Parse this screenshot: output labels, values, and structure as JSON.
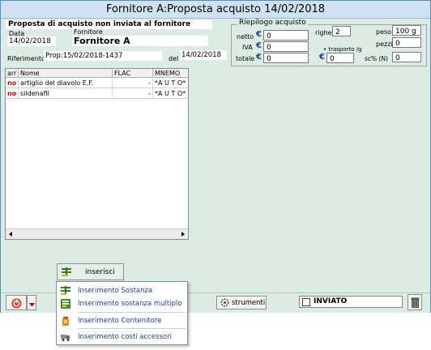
{
  "window": {
    "title": "Fornitore A:Proposta acquisto 14/02/2018"
  },
  "header": {
    "status_text": "Proposta di acquisto non inviata al fornitore",
    "data_label": "Data",
    "data_value": "14/02/2018",
    "fornitore_label": "Fornitore",
    "fornitore_value": "Fornitore A",
    "riferimento_label": "Riferimento",
    "riferimento_value": "Prop:15/02/2018-1437",
    "del_label": "del",
    "del_value": "14/02/2018"
  },
  "riepilogo": {
    "title": "Riepilogo acquisto",
    "currency_symbol": "€",
    "netto_label": "netto",
    "netto_value": "0",
    "iva_label": "IVA",
    "iva_value": "0",
    "totale_label": "totale",
    "totale_value": "0",
    "righe_label": "righe",
    "righe_value": "2",
    "peso_label": "peso",
    "peso_value": "100 g",
    "pezzi_label": "pezzi",
    "pezzi_value": "0",
    "trasporto_label": "• trasporto /g",
    "trasporto_value": "0",
    "sc_label": "sc% (N)",
    "sc_value": "0"
  },
  "table": {
    "columns": [
      "arr",
      "Nome",
      "FLAC",
      "MNEMO"
    ],
    "rows": [
      {
        "arr": "no",
        "nome": "artiglio del diavolo E.F.",
        "flac": "-",
        "mnemo": "*A U T O*"
      },
      {
        "arr": "no",
        "nome": "sildenafil",
        "flac": "-",
        "mnemo": "*A U T O*"
      }
    ]
  },
  "toolbar": {
    "inserisci_label": "inserisci",
    "strumenti_label": "strumenti",
    "inviato_label": "INVIATO"
  },
  "menu": {
    "items": [
      "Inserimento Sostanza",
      "Inserimento sostanza multiplo",
      "Inserimento Contenitore",
      "Inserimento costi accessori"
    ]
  }
}
